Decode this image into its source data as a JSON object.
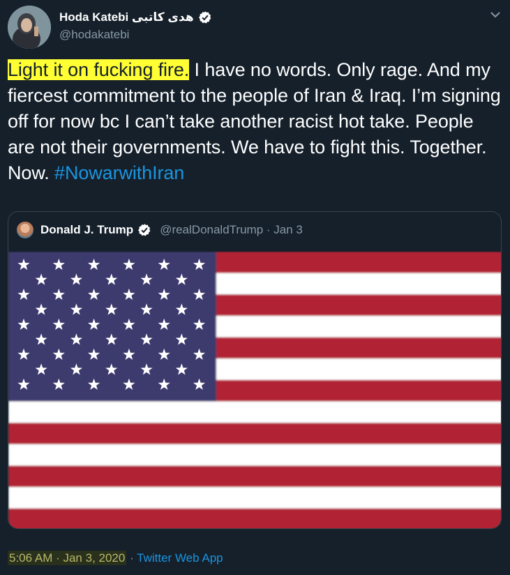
{
  "author": {
    "display_name": "Hoda Katebi هدی کاتبی",
    "handle": "@hodakatebi",
    "verified": true
  },
  "tweet": {
    "highlight_text": "Light it on fucking fire.",
    "body_text": " I have no words. Only rage. And my fiercest commitment to the people of Iran & Iraq. I’m signing off for now bc I can’t take another racist hot take. People are not their governments. We have to fight this. Together. Now. ",
    "hashtag": "#NowarwithIran"
  },
  "quoted_tweet": {
    "display_name": "Donald J. Trump",
    "handle": "@realDonaldTrump",
    "date": "Jan 3",
    "separator": "·",
    "verified": true,
    "media": "us-flag-image"
  },
  "meta": {
    "time": "5:06 AM · Jan 3, 2020",
    "separator": " · ",
    "source": "Twitter Web App"
  },
  "colors": {
    "background": "#15202b",
    "text": "#ffffff",
    "muted": "#8899a6",
    "link": "#1b95e0",
    "highlight": "#ffff33",
    "border": "#38444d"
  },
  "icons": [
    "chevron-down-icon",
    "verified-badge-icon"
  ]
}
